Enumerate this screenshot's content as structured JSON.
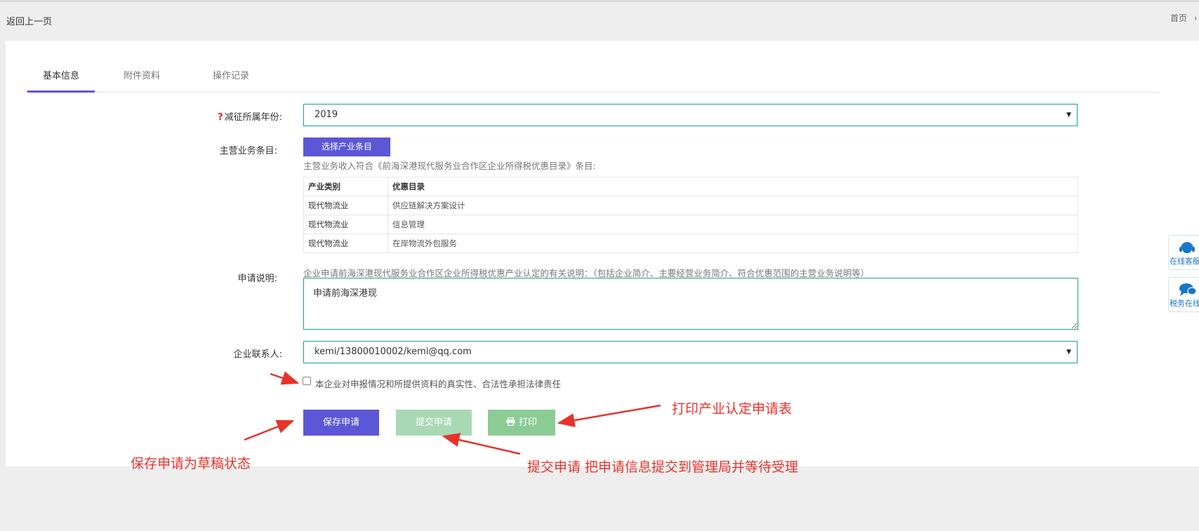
{
  "header": {
    "back_label": "返回上一页",
    "breadcrumb_home": "首页",
    "breadcrumb_sep": "›"
  },
  "tabs": [
    {
      "label": "基本信息",
      "active": true
    },
    {
      "label": "附件资料",
      "active": false
    },
    {
      "label": "操作记录",
      "active": false
    }
  ],
  "form": {
    "year": {
      "required_mark": "?",
      "label": "减征所属年份:",
      "value": "2019"
    },
    "business": {
      "label": "主营业务条目:",
      "pick_button": "选择产业条目",
      "hint": "主营业务收入符合《前海深港现代服务业合作区企业所得税优惠目录》条目:",
      "table": {
        "headers": [
          "产业类别",
          "优惠目录"
        ],
        "rows": [
          [
            "现代物流业",
            "供应链解决方案设计"
          ],
          [
            "现代物流业",
            "信息管理"
          ],
          [
            "现代物流业",
            "在岸物流外包服务"
          ]
        ]
      }
    },
    "description": {
      "label": "申请说明:",
      "hint": "企业申请前海深港现代服务业合作区企业所得税优惠产业认定的有关说明：（包括企业简介、主要经营业务简介、符合优惠范围的主营业务说明等）",
      "value": "申请前海深港现"
    },
    "contact": {
      "label": "企业联系人:",
      "value": "kemi/13800010002/kemi@qq.com"
    },
    "declaration": {
      "label": "本企业对申报情况和所提供资料的真实性、合法性承担法律责任",
      "checked": false
    }
  },
  "buttons": {
    "save": "保存申请",
    "submit": "提交申请",
    "print": "打印"
  },
  "annotations": {
    "print": "打印产业认定申请表",
    "save": "保存申请为草稿状态",
    "submit": "提交申请 把申请信息提交到管理局并等待受理"
  },
  "float": {
    "online_service": "在线客服",
    "tax_online": "税务在线"
  },
  "colors": {
    "accent": "#5b57d6",
    "input_border": "#1aa188",
    "annotation": "#e8322a",
    "print_btn": "#8bcc95",
    "submit_btn_disabled": "#a8d9b4"
  }
}
